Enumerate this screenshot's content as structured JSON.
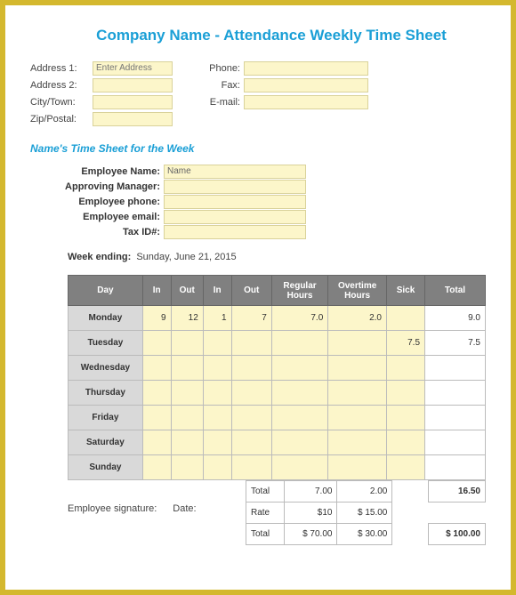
{
  "title": "Company Name - Attendance Weekly Time Sheet",
  "company": {
    "labels": {
      "address1": "Address 1:",
      "address2": "Address 2:",
      "city": "City/Town:",
      "zip": "Zip/Postal:",
      "phone": "Phone:",
      "fax": "Fax:",
      "email": "E-mail:"
    },
    "address1_placeholder": "Enter Address"
  },
  "subtitle": "Name's Time Sheet for the Week",
  "employee": {
    "labels": {
      "name": "Employee Name:",
      "manager": "Approving Manager:",
      "phone": "Employee phone:",
      "email": "Employee email:",
      "taxid": "Tax ID#:"
    },
    "name_value": "Name"
  },
  "week": {
    "label": "Week ending:",
    "value": "Sunday, June 21, 2015"
  },
  "chart_data": {
    "type": "table",
    "columns": [
      "Day",
      "In",
      "Out",
      "In",
      "Out",
      "Regular Hours",
      "Overtime Hours",
      "Sick",
      "Total"
    ],
    "rows": [
      {
        "day": "Monday",
        "in1": "9",
        "out1": "12",
        "in2": "1",
        "out2": "7",
        "reg": "7.0",
        "ot": "2.0",
        "sick": "",
        "total": "9.0"
      },
      {
        "day": "Tuesday",
        "in1": "",
        "out1": "",
        "in2": "",
        "out2": "",
        "reg": "",
        "ot": "",
        "sick": "7.5",
        "total": "7.5"
      },
      {
        "day": "Wednesday",
        "in1": "",
        "out1": "",
        "in2": "",
        "out2": "",
        "reg": "",
        "ot": "",
        "sick": "",
        "total": ""
      },
      {
        "day": "Thursday",
        "in1": "",
        "out1": "",
        "in2": "",
        "out2": "",
        "reg": "",
        "ot": "",
        "sick": "",
        "total": ""
      },
      {
        "day": "Friday",
        "in1": "",
        "out1": "",
        "in2": "",
        "out2": "",
        "reg": "",
        "ot": "",
        "sick": "",
        "total": ""
      },
      {
        "day": "Saturday",
        "in1": "",
        "out1": "",
        "in2": "",
        "out2": "",
        "reg": "",
        "ot": "",
        "sick": "",
        "total": ""
      },
      {
        "day": "Sunday",
        "in1": "",
        "out1": "",
        "in2": "",
        "out2": "",
        "reg": "",
        "ot": "",
        "sick": "",
        "total": ""
      }
    ],
    "totals": {
      "total_label": "Total",
      "rate_label": "Rate",
      "reg_hours": "7.00",
      "ot_hours": "2.00",
      "total_hours": "16.50",
      "reg_rate": "$10",
      "ot_rate": "$   15.00",
      "reg_pay": "$   70.00",
      "ot_pay": "$   30.00",
      "total_pay": "$   100.00"
    }
  },
  "signature": {
    "sig_label": "Employee signature:",
    "date_label": "Date:"
  }
}
